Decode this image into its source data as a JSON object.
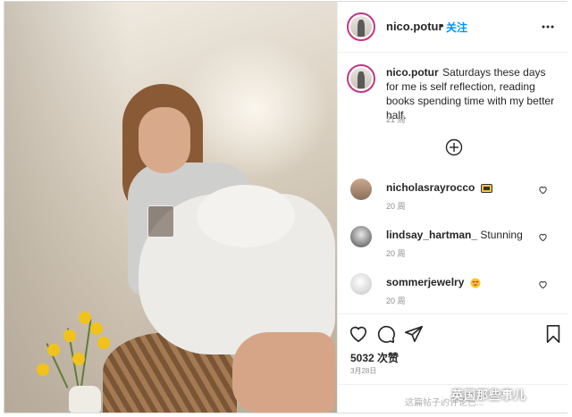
{
  "post": {
    "username": "nico.potur",
    "dot": "•",
    "follow_label": "关注",
    "caption_user": "nico.potur",
    "caption_text": "Saturdays these days for me is self reflection, reading books spending time with my better half.",
    "caption_time": "21 周"
  },
  "comments": [
    {
      "user": "nicholasrayrocco",
      "text": "",
      "emoji": "yellow-box-emoji",
      "time": "20 周"
    },
    {
      "user": "lindsay_hartman_",
      "text": "Stunning",
      "emoji": "",
      "time": "20 周"
    },
    {
      "user": "sommerjewelry",
      "text": "",
      "emoji": "heart-eyes-emoji",
      "time": "20 周"
    }
  ],
  "actions": {
    "likes": "5032 次赞",
    "date": "3月28日"
  },
  "comment_bar": {
    "placeholder": "这篇帖子的评论已..."
  },
  "watermark": {
    "text": "英国那些事儿"
  },
  "icons": {
    "more": "more-options-icon",
    "plus": "load-more-comments-icon",
    "heart": "heart-icon",
    "comment": "comment-icon",
    "share": "share-icon",
    "save": "bookmark-icon"
  },
  "colors": {
    "follow": "#0095f6",
    "story_ring": "#c13584",
    "muted": "#8e8e8e"
  }
}
